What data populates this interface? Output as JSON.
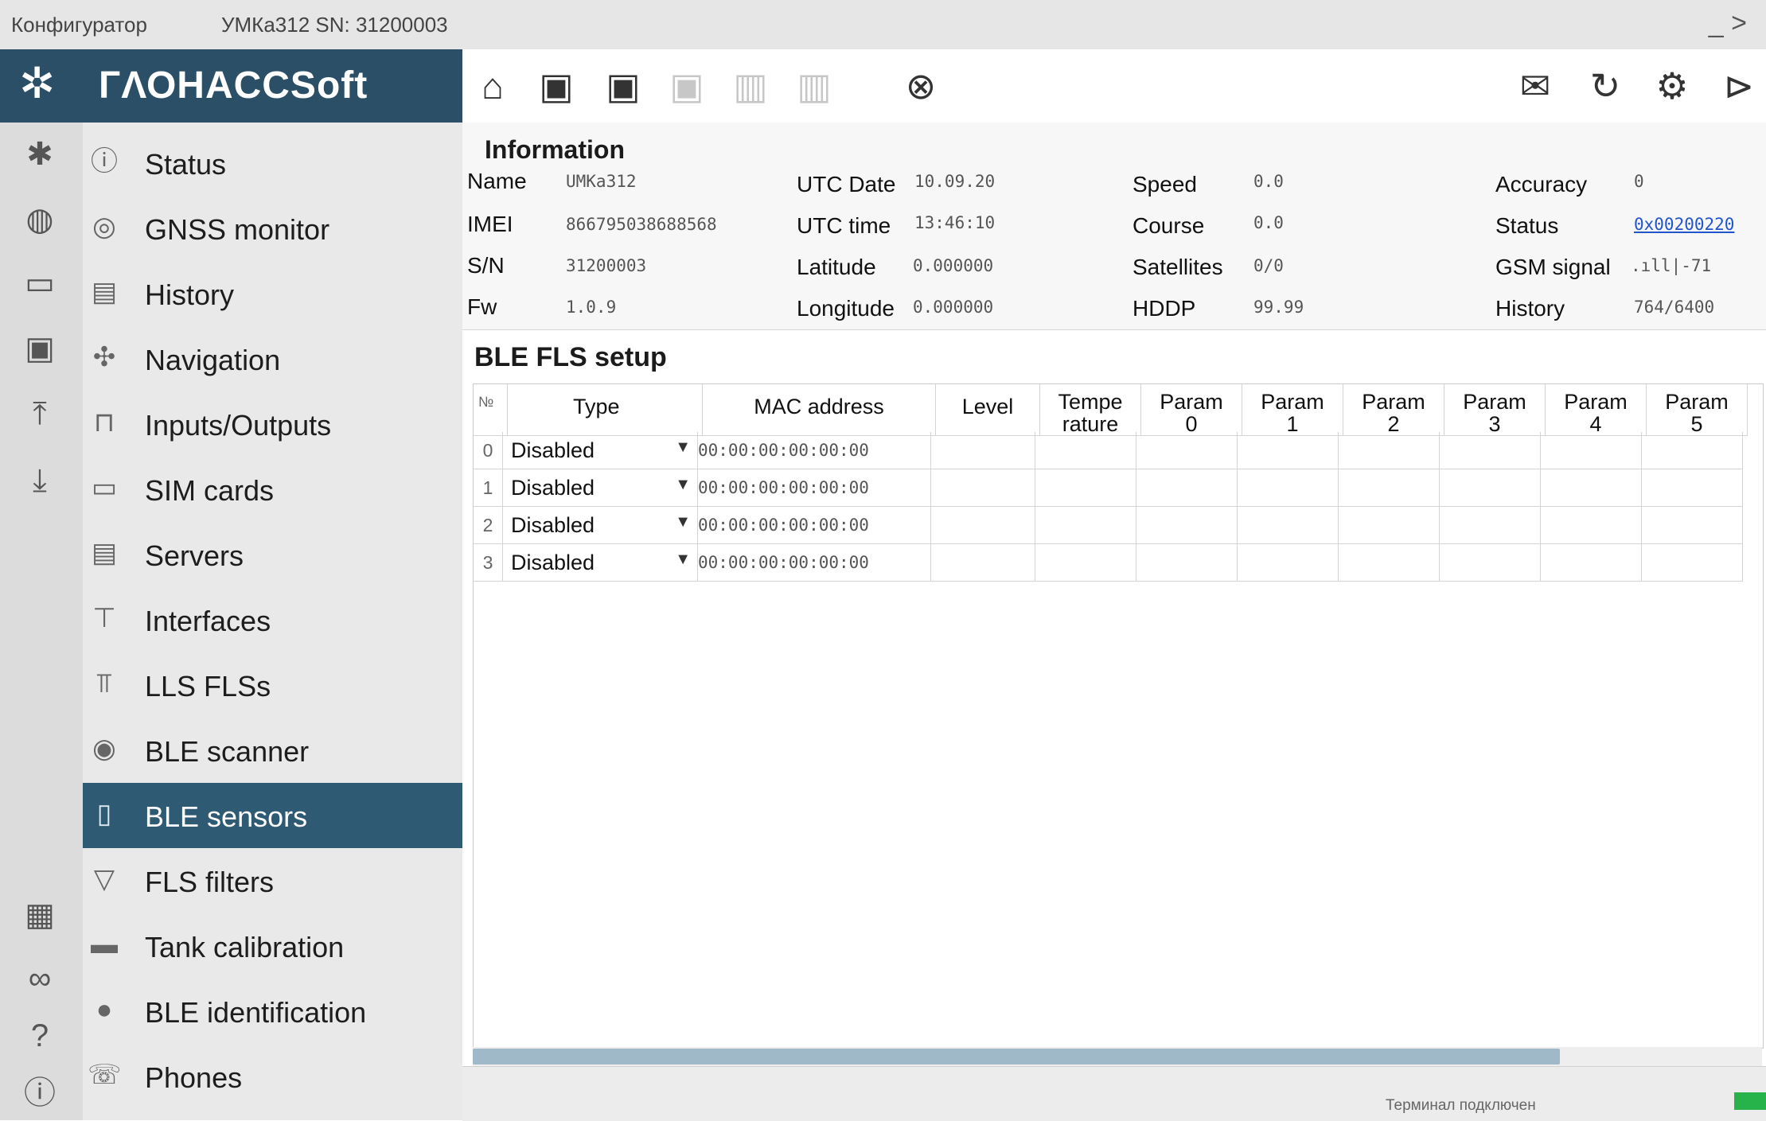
{
  "window": {
    "app_title": "Конфигуратор",
    "device_title": "УМКа312 SN: 31200003",
    "minimize": "_ >"
  },
  "brand": {
    "name": "ГΛΟΗΑCCSoft"
  },
  "rail": [
    {
      "icon": "bluetooth-icon",
      "glyph": "✱"
    },
    {
      "icon": "globe-icon",
      "glyph": "◍"
    },
    {
      "icon": "folder-icon",
      "glyph": "▭"
    },
    {
      "icon": "save-icon",
      "glyph": "▣"
    },
    {
      "icon": "upload-icon",
      "glyph": "⤒"
    },
    {
      "icon": "download-icon",
      "glyph": "⤓"
    },
    {
      "icon": "grid-icon",
      "glyph": "▦"
    },
    {
      "icon": "link-icon",
      "glyph": "∞"
    },
    {
      "icon": "help-icon",
      "glyph": "?"
    },
    {
      "icon": "info-icon",
      "glyph": "ⓘ"
    }
  ],
  "nav": {
    "items": [
      {
        "label": "Status",
        "icon": "info-icon",
        "glyph": "ⓘ"
      },
      {
        "label": "GNSS monitor",
        "icon": "satellite-dish-icon",
        "glyph": "◎"
      },
      {
        "label": "History",
        "icon": "book-icon",
        "glyph": "▤"
      },
      {
        "label": "Navigation",
        "icon": "navigation-icon",
        "glyph": "✣"
      },
      {
        "label": "Inputs/Outputs",
        "icon": "plug-icon",
        "glyph": "⊓"
      },
      {
        "label": "SIM cards",
        "icon": "sim-card-icon",
        "glyph": "▭"
      },
      {
        "label": "Servers",
        "icon": "server-icon",
        "glyph": "▤"
      },
      {
        "label": "Interfaces",
        "icon": "connector-icon",
        "glyph": "⊤"
      },
      {
        "label": "LLS FLSs",
        "icon": "fuel-sensor-icon",
        "glyph": "⫪"
      },
      {
        "label": "BLE scanner",
        "icon": "bluetooth-scan-icon",
        "glyph": "◉"
      },
      {
        "label": "BLE sensors",
        "icon": "ble-sensor-icon",
        "glyph": "▯"
      },
      {
        "label": "FLS filters",
        "icon": "filter-icon",
        "glyph": "▽"
      },
      {
        "label": "Tank calibration",
        "icon": "tank-icon",
        "glyph": "▬"
      },
      {
        "label": "BLE identification",
        "icon": "fingerprint-icon",
        "glyph": "●"
      },
      {
        "label": "Phones",
        "icon": "phone-icon",
        "glyph": "☏"
      }
    ],
    "active": "BLE sensors"
  },
  "toolbar": {
    "left": [
      {
        "icon": "antenna-home-icon",
        "glyph": "⌂",
        "enabled": true
      },
      {
        "icon": "device-read-icon",
        "glyph": "▣",
        "enabled": true
      },
      {
        "icon": "device-write-icon",
        "glyph": "▣",
        "enabled": true
      },
      {
        "icon": "device-config-icon",
        "glyph": "▣",
        "enabled": false
      },
      {
        "icon": "database-read-icon",
        "glyph": "▥",
        "enabled": false
      },
      {
        "icon": "database-write-icon",
        "glyph": "▥",
        "enabled": false
      },
      {
        "icon": "location-off-icon",
        "glyph": "⊗",
        "enabled": true
      }
    ],
    "right": [
      {
        "icon": "mail-icon",
        "glyph": "✉"
      },
      {
        "icon": "file-refresh-icon",
        "glyph": "↻"
      },
      {
        "icon": "sim-settings-icon",
        "glyph": "⚙"
      },
      {
        "icon": "playback-icon",
        "glyph": "⊳"
      }
    ]
  },
  "info": {
    "title": "Information",
    "fields": {
      "name": {
        "label": "Name",
        "value": "UMKa312"
      },
      "imei": {
        "label": "IMEI",
        "value": "866795038688568"
      },
      "sn": {
        "label": "S/N",
        "value": "31200003"
      },
      "fw": {
        "label": "Fw",
        "value": "1.0.9"
      },
      "utc_date": {
        "label": "UTC Date",
        "value": "10.09.20"
      },
      "utc_time": {
        "label": "UTC time",
        "value": "13:46:10"
      },
      "latitude": {
        "label": "Latitude",
        "value": "0.000000"
      },
      "longitude": {
        "label": "Longitude",
        "value": "0.000000"
      },
      "speed": {
        "label": "Speed",
        "value": "0.0"
      },
      "course": {
        "label": "Course",
        "value": "0.0"
      },
      "satellites": {
        "label": "Satellites",
        "value": "0/0"
      },
      "hddp": {
        "label": "HDDP",
        "value": "99.99"
      },
      "accuracy": {
        "label": "Accuracy",
        "value": "0"
      },
      "status": {
        "label": "Status",
        "value": "0x00200220"
      },
      "gsm_signal": {
        "label": "GSM signal",
        "value": ".ıll|-71"
      },
      "history": {
        "label": "History",
        "value": "764/6400"
      }
    }
  },
  "ble": {
    "title": "BLE FLS setup",
    "columns": {
      "no": "№",
      "type": "Type",
      "mac": "MAC address",
      "level": "Level",
      "temp_1": "Tempe",
      "temp_2": "rature",
      "param": "Param",
      "p0": "0",
      "p1": "1",
      "p2": "2",
      "p3": "3",
      "p4": "4",
      "p5": "5"
    },
    "rows": [
      {
        "no": "0",
        "type": "Disabled",
        "mac": "00:00:00:00:00:00"
      },
      {
        "no": "1",
        "type": "Disabled",
        "mac": "00:00:00:00:00:00"
      },
      {
        "no": "2",
        "type": "Disabled",
        "mac": "00:00:00:00:00:00"
      },
      {
        "no": "3",
        "type": "Disabled",
        "mac": "00:00:00:00:00:00"
      }
    ]
  },
  "statusbar": {
    "text": "Терминал подключен"
  },
  "colors": {
    "brand": "#2b4f66",
    "active_nav": "#2f5a74",
    "link": "#2255cc",
    "led": "#27b34a"
  }
}
